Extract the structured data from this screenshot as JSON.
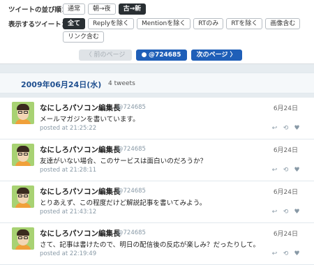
{
  "options": {
    "order_label": "ツイートの並び順：",
    "order_chips": [
      "通常",
      "朝→夜",
      "古→新"
    ],
    "filter_label": "表示するツイート：",
    "filter_chips_row1": [
      "全て",
      "Replyを除く",
      "Mentionを除く",
      "RTのみ",
      "RTを除く",
      "画像含む"
    ],
    "filter_chips_row2": [
      "リンク含む"
    ]
  },
  "pager": {
    "prev_label": "〈 前のページ",
    "user_label": "@724685",
    "next_label": "次のページ 〉"
  },
  "date_header": {
    "date": "2009年06月24日(水)",
    "count": "4 tweets"
  },
  "tweets": [
    {
      "name": "なにしろパソコン編集長",
      "handle": "@724685",
      "date": "6月24日",
      "text": "メールマガジンを書いています。",
      "time": "posted at 21:25:22"
    },
    {
      "name": "なにしろパソコン編集長",
      "handle": "@724685",
      "date": "6月24日",
      "text": "友達がいない場合、このサービスは面白いのだろうか？",
      "time": "posted at 21:28:11"
    },
    {
      "name": "なにしろパソコン編集長",
      "handle": "@724685",
      "date": "6月24日",
      "text": "とりあえず、この程度だけど解説記事を書いてみよう。",
      "time": "posted at 21:43:12"
    },
    {
      "name": "なにしろパソコン編集長",
      "handle": "@724685",
      "date": "6月24日",
      "text": "さて、記事は書けたので、明日の配信後の反応が楽しみ？だったりして。",
      "time": "posted at 22:19:49"
    }
  ],
  "icons": {
    "reply": "reply-icon",
    "retweet": "retweet-icon",
    "favorite": "heart-icon"
  }
}
